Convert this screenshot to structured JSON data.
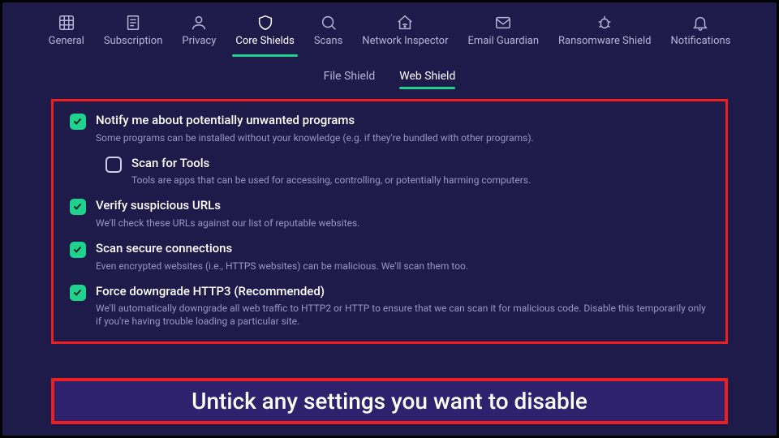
{
  "nav": [
    {
      "id": "general",
      "label": "General",
      "icon": "grid"
    },
    {
      "id": "subscription",
      "label": "Subscription",
      "icon": "receipt"
    },
    {
      "id": "privacy",
      "label": "Privacy",
      "icon": "user"
    },
    {
      "id": "core-shields",
      "label": "Core Shields",
      "icon": "shield",
      "active": true
    },
    {
      "id": "scans",
      "label": "Scans",
      "icon": "search"
    },
    {
      "id": "network-inspector",
      "label": "Network Inspector",
      "icon": "home-wifi"
    },
    {
      "id": "email-guardian",
      "label": "Email Guardian",
      "icon": "mail"
    },
    {
      "id": "ransomware-shield",
      "label": "Ransomware Shield",
      "icon": "bug"
    },
    {
      "id": "notifications",
      "label": "Notifications",
      "icon": "bell"
    }
  ],
  "subtabs": [
    {
      "id": "file-shield",
      "label": "File Shield",
      "active": false
    },
    {
      "id": "web-shield",
      "label": "Web Shield",
      "active": true
    }
  ],
  "options": [
    {
      "id": "notify-pup",
      "checked": true,
      "title": "Notify me about potentially unwanted programs",
      "desc": "Some programs can be installed without your knowledge (e.g. if they're bundled with other programs)."
    },
    {
      "id": "scan-tools",
      "checked": false,
      "nested": true,
      "title": "Scan for Tools",
      "desc": "Tools are apps that can be used for accessing, controlling, or potentially harming computers."
    },
    {
      "id": "verify-urls",
      "checked": true,
      "title": "Verify suspicious URLs",
      "desc": "We'll check these URLs against our list of reputable websites."
    },
    {
      "id": "scan-secure",
      "checked": true,
      "title": "Scan secure connections",
      "desc": "Even encrypted websites (i.e., HTTPS websites) can be malicious. We'll scan them too."
    },
    {
      "id": "force-http3",
      "checked": true,
      "title": "Force downgrade HTTP3 (Recommended)",
      "desc": "We'll automatically downgrade all web traffic to HTTP2 or HTTP to ensure that we can scan it for malicious code. Disable this temporarily only if you're having trouble loading a particular site."
    }
  ],
  "callout": "Untick any settings you want to disable"
}
